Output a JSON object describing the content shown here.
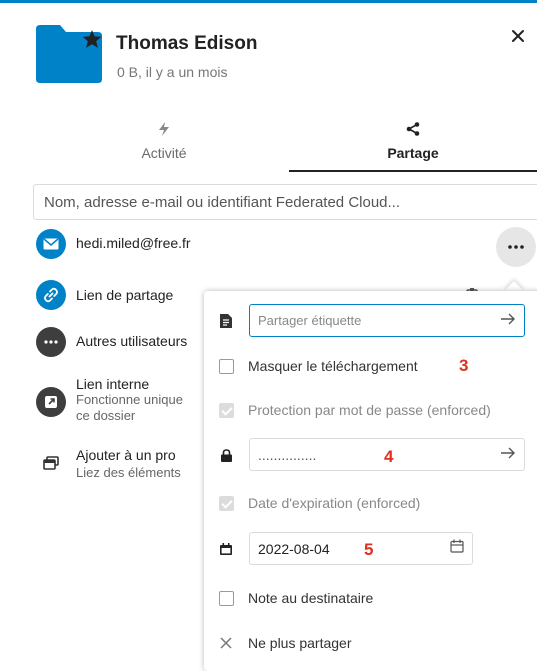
{
  "header": {
    "title": "Thomas Edison",
    "subtitle": "0 B, il y a un mois"
  },
  "tabs": [
    {
      "label": "Activité",
      "active": false
    },
    {
      "label": "Partage",
      "active": true
    }
  ],
  "search": {
    "placeholder": "Nom, adresse e-mail ou identifiant Federated Cloud..."
  },
  "shares": [
    {
      "label": "hedi.miled@free.fr",
      "icon": "email-icon"
    },
    {
      "label": "Lien de partage",
      "icon": "link-icon"
    },
    {
      "label": "Autres utilisateurs",
      "icon": "more-icon"
    },
    {
      "label": "Lien interne",
      "sub1": "Fonctionne unique",
      "sub2": "ce dossier",
      "icon": "external-link-icon"
    },
    {
      "label": "Ajouter à un pro",
      "sub1": "Liez des éléments",
      "icon": "projects-icon"
    }
  ],
  "menu": {
    "label_placeholder": "Partager étiquette",
    "hide_download": "Masquer le téléchargement",
    "password_protect": "Protection par mot de passe (enforced)",
    "password_value": "...............",
    "expiration": "Date d'expiration (enforced)",
    "expiration_date": "2022-08-04",
    "note": "Note au destinataire",
    "unshare": "Ne plus partager"
  },
  "annotations": {
    "n3": "3",
    "n4": "4",
    "n5": "5"
  },
  "colors": {
    "accent": "#0082c9",
    "annotation": "#e0301e"
  }
}
